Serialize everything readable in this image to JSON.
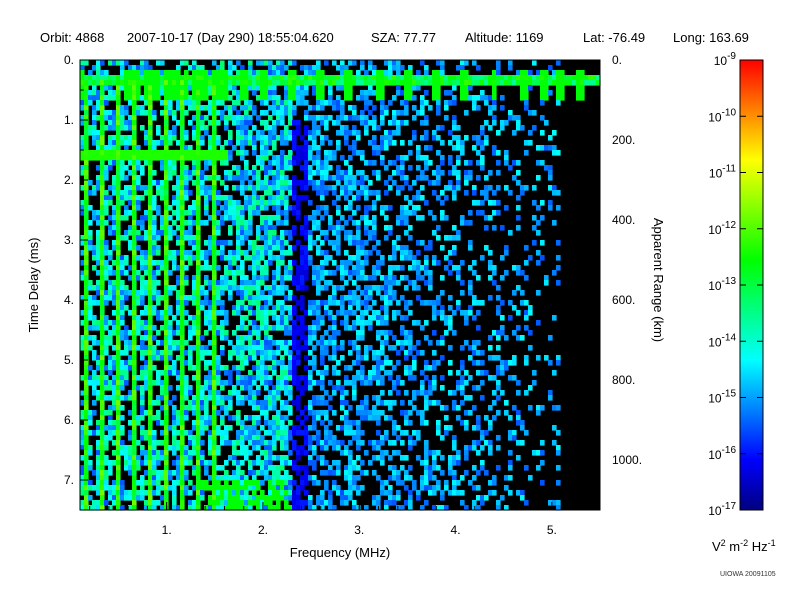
{
  "header": {
    "orbit": "Orbit: 4868",
    "time": "2007-10-17 (Day 290) 18:55:04.620",
    "sza": "SZA:  77.77",
    "altitude": "Altitude:     1169",
    "lat": "Lat: -76.49",
    "long": "Long: 163.69"
  },
  "credit": "UIOWA 20091105",
  "chart_data": {
    "type": "heatmap",
    "xlabel": "Frequency (MHz)",
    "ylabel": "Time Delay (ms)",
    "y2label": "Apparent Range (km)",
    "xlim": [
      0.1,
      5.5
    ],
    "ylim": [
      7.5,
      0.0
    ],
    "y2lim": [
      1125,
      0
    ],
    "x_ticks": [
      1,
      2,
      3,
      4,
      5
    ],
    "x_tick_labels": [
      "1.",
      "2.",
      "3.",
      "4.",
      "5."
    ],
    "y_ticks": [
      0,
      1,
      2,
      3,
      4,
      5,
      6,
      7
    ],
    "y_tick_labels": [
      "0.",
      "1.",
      "2.",
      "3.",
      "4.",
      "5.",
      "6.",
      "7."
    ],
    "y2_ticks": [
      0,
      200,
      400,
      600,
      800,
      1000
    ],
    "y2_tick_labels": [
      "0.",
      "200.",
      "400.",
      "600.",
      "800.",
      "1000."
    ],
    "colorbar": {
      "label": "V",
      "label_parts": [
        "V",
        "2",
        " m",
        "-2",
        " Hz",
        "-1"
      ],
      "scale": "log",
      "range": [
        -17,
        -9
      ],
      "ticks": [
        -17,
        -16,
        -15,
        -14,
        -13,
        -12,
        -11,
        -10,
        -9
      ],
      "tick_base": "10",
      "tick_exponents": [
        "-17",
        "-16",
        "-15",
        "-14",
        "-13",
        "-12",
        "-11",
        "-10",
        "-9"
      ],
      "colors": [
        "#000080",
        "#0000ff",
        "#0080ff",
        "#00ffff",
        "#00ff80",
        "#00ff00",
        "#80ff00",
        "#ffff00",
        "#ff8000",
        "#ff0000"
      ]
    },
    "features": {
      "surface_echo_delay_ms": 0.3,
      "surface_echo_frequencies_mhz": [
        0.1,
        0.6,
        0.7,
        0.8,
        0.9,
        1.0,
        1.1,
        1.2,
        1.3,
        1.4,
        1.5,
        1.6,
        1.8,
        2.0,
        2.3,
        2.6,
        2.9,
        3.2,
        3.5,
        3.8,
        4.1,
        4.4,
        4.7,
        4.9,
        5.1,
        5.3
      ],
      "harmonic_lines_mhz": [
        0.17,
        0.33,
        0.5,
        0.66,
        0.83,
        1.0,
        1.16,
        1.33,
        1.5
      ],
      "oblique_echo_delay_ms": 1.55,
      "noise_cutoff_mhz": 5.1
    }
  }
}
